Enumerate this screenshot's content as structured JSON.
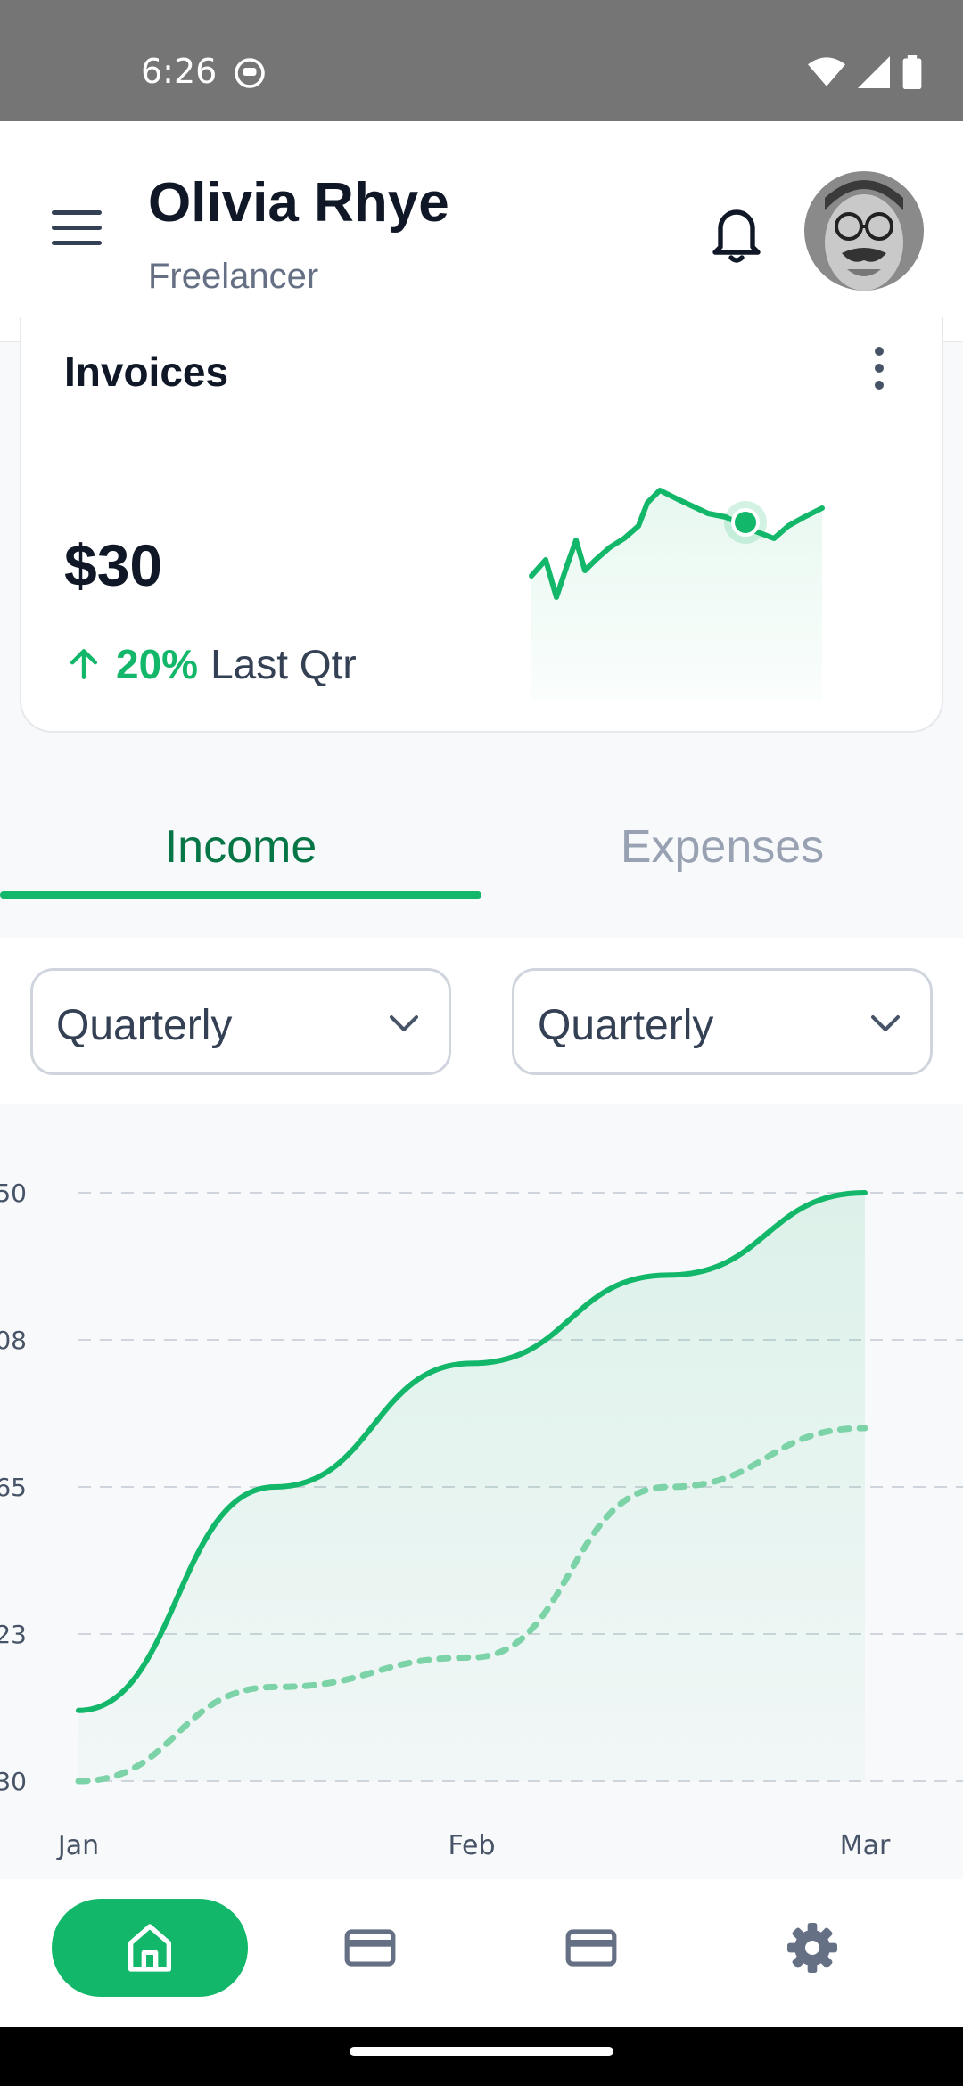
{
  "status_bar": {
    "time": "6:26"
  },
  "header": {
    "name": "Olivia Rhye",
    "role": "Freelancer"
  },
  "invoice_card": {
    "title": "Invoices",
    "amount": "$30",
    "change_pct": "20%",
    "change_label": "Last Qtr"
  },
  "tabs": [
    {
      "label": "Income",
      "active": true
    },
    {
      "label": "Expenses",
      "active": false
    }
  ],
  "filters": {
    "period_1": "Quarterly",
    "period_2": "Quarterly"
  },
  "colors": {
    "accent": "#12b76a",
    "accent_dark": "#067647",
    "muted": "#98a2b3"
  },
  "chart_data": {
    "type": "area",
    "categories": [
      "Jan",
      "Feb",
      "Mar"
    ],
    "y_ticks_visible": [
      "50",
      "08",
      "65",
      "23",
      "30"
    ],
    "series": [
      {
        "line_style": "solid",
        "x": [
          0,
          0.25,
          0.5,
          0.75,
          1.0
        ],
        "y_frac": [
          0.12,
          0.5,
          0.71,
          0.86,
          1.0
        ]
      },
      {
        "line_style": "dotted",
        "x": [
          0,
          0.25,
          0.5,
          0.75,
          1.0
        ],
        "y_frac": [
          0.0,
          0.16,
          0.21,
          0.5,
          0.6
        ]
      }
    ],
    "grid": true,
    "grid_style": "dashed horizontal"
  },
  "bottom_nav": [
    {
      "icon": "home-icon",
      "active": true
    },
    {
      "icon": "credit-card-icon",
      "active": false
    },
    {
      "icon": "credit-card-icon",
      "active": false
    },
    {
      "icon": "gear-icon",
      "active": false
    }
  ]
}
